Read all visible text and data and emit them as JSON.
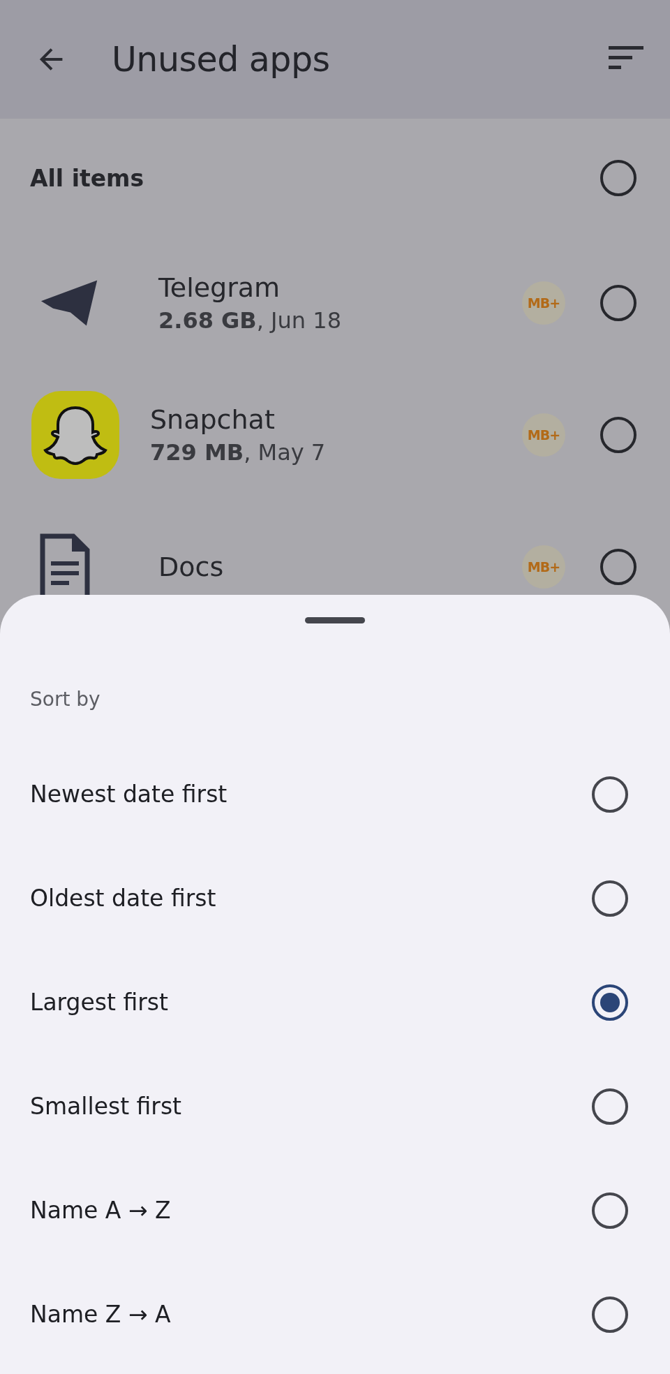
{
  "app_bar": {
    "title": "Unused apps"
  },
  "all_items": {
    "label": "All items",
    "checked": false
  },
  "apps": [
    {
      "kind": "telegram",
      "name": "Telegram",
      "detail": "**2.68 GB**, Jun 18",
      "badge": "MB+",
      "checked": false
    },
    {
      "kind": "snapchat",
      "name": "Snapchat",
      "detail": "**729 MB**, May 7",
      "badge": "MB+",
      "checked": false
    },
    {
      "kind": "docs",
      "name": "Docs",
      "badge": "MB+",
      "checked": false
    }
  ],
  "sort_sheet": {
    "title": "Sort by",
    "options": [
      {
        "label": "Newest date first",
        "selected": false
      },
      {
        "label": "Oldest date first",
        "selected": false
      },
      {
        "label": "Largest first",
        "selected": true
      },
      {
        "label": "Smallest first",
        "selected": false
      },
      {
        "label": "Name A → Z",
        "selected": false
      },
      {
        "label": "Name Z → A",
        "selected": false
      }
    ]
  }
}
